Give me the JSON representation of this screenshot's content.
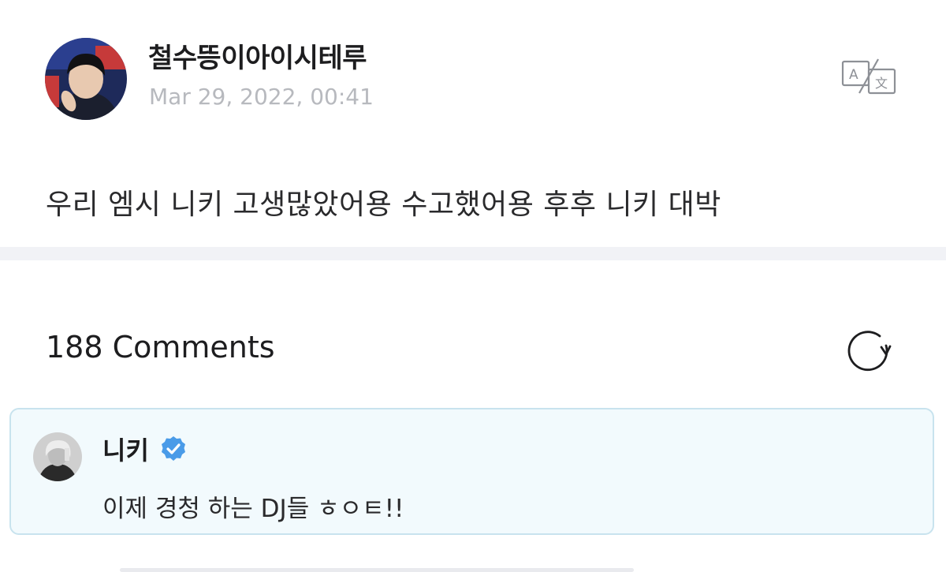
{
  "post": {
    "author": "철수뜽이아이시테루",
    "date": "Mar 29, 2022, 00:41",
    "body": "우리 엠시 니키 고생많았어용 수고했어용 후후 니키 대박",
    "avatar_icon": "user-photo-avatar",
    "translate_icon": "translate-icon"
  },
  "comments": {
    "count_label": "188 Comments",
    "refresh_icon": "refresh-icon",
    "items": [
      {
        "author": "니키",
        "verified": true,
        "verified_color": "#4a9be8",
        "text": "이제 경청 하는 DJ들 ㅎㅇㅌ!!",
        "highlight_bg": "#f2fafd",
        "highlight_border": "#c8e3ee"
      }
    ]
  },
  "colors": {
    "text_primary": "#1d1d1f",
    "text_muted": "#b7b9be",
    "divider": "#f1f2f6"
  }
}
